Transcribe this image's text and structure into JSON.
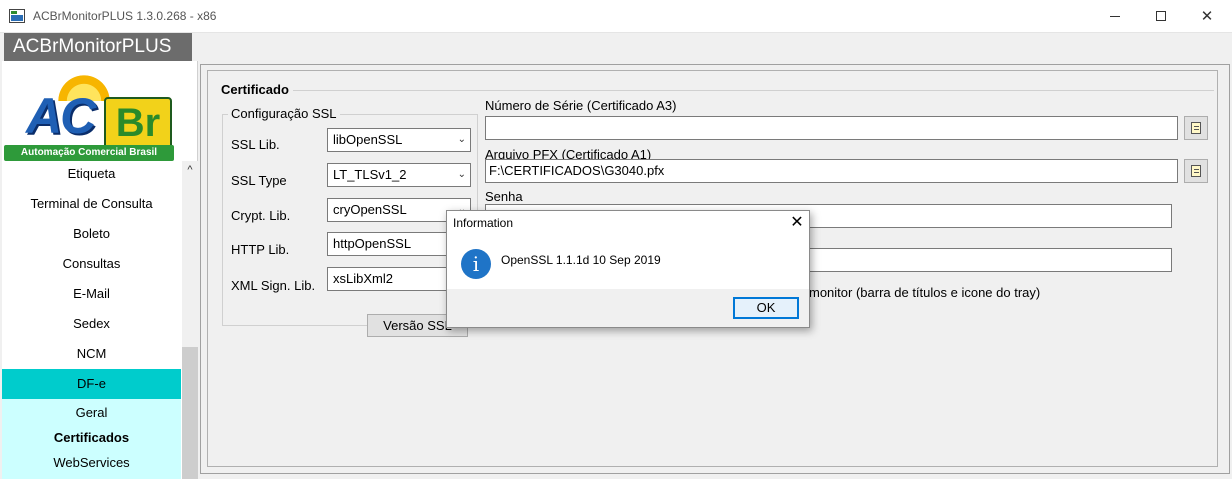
{
  "window": {
    "title": "ACBrMonitorPLUS 1.3.0.268 - x86",
    "minimize": "",
    "close": "✕"
  },
  "app": {
    "header": "ACBrMonitorPLUS",
    "logo_text_ac": "AC",
    "logo_text_br": "Br",
    "logo_tagline": "Automação Comercial Brasil"
  },
  "sidebar": {
    "items": [
      {
        "label": "Etiqueta"
      },
      {
        "label": "Terminal de Consulta"
      },
      {
        "label": "Boleto"
      },
      {
        "label": "Consultas"
      },
      {
        "label": "E-Mail"
      },
      {
        "label": "Sedex"
      },
      {
        "label": "NCM"
      },
      {
        "label": "DF-e",
        "active": true
      }
    ],
    "subitems": [
      {
        "label": "Geral"
      },
      {
        "label": "Certificados",
        "selected": true
      },
      {
        "label": "WebServices"
      }
    ],
    "scroll_up": "^"
  },
  "main": {
    "section_title": "Certificado",
    "ssl_group": {
      "title": "Configuração SSL",
      "fields": [
        {
          "label": "SSL Lib.",
          "value": "libOpenSSL"
        },
        {
          "label": "SSL Type",
          "value": "LT_TLSv1_2"
        },
        {
          "label": "Crypt. Lib.",
          "value": "cryOpenSSL"
        },
        {
          "label": "HTTP Lib.",
          "value": "httpOpenSSL"
        },
        {
          "label": "XML Sign. Lib.",
          "value": "xsLibXml2"
        }
      ],
      "versao_button": "Versão SSL"
    },
    "numero_serie": {
      "label": "Número de Série (Certificado A3)",
      "value": ""
    },
    "arquivo_pfx": {
      "label": "Arquivo PFX (Certificado A1)",
      "value": "F:\\CERTIFICADOS\\G3040.pfx"
    },
    "senha": {
      "label": "Senha",
      "value": ""
    },
    "checkbox_text": "monitor (barra de títulos e icone do tray)"
  },
  "dialog": {
    "title": "Information",
    "message": "OpenSSL 1.1.1d  10 Sep 2019",
    "ok": "OK",
    "close": "✕",
    "icon": "i"
  },
  "colors": {
    "active_menu": "#00cccc",
    "submenu_bg": "#ccffff",
    "header_bg": "#6c6c6c",
    "info_icon": "#1f74c7"
  }
}
